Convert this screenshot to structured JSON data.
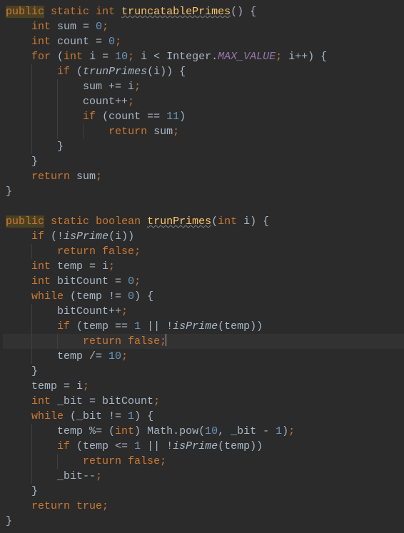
{
  "lang": "java",
  "lines": [
    {
      "i": 0,
      "hl": false,
      "tokens": [
        {
          "t": "public",
          "c": "kw-hi"
        },
        {
          "t": " "
        },
        {
          "t": "static",
          "c": "kw"
        },
        {
          "t": " "
        },
        {
          "t": "int",
          "c": "kw"
        },
        {
          "t": " "
        },
        {
          "t": "truncatablePrimes",
          "c": "fn-warn"
        },
        {
          "t": "() {",
          "c": "op"
        }
      ]
    },
    {
      "i": 1,
      "hl": false,
      "tokens": [
        {
          "t": "int",
          "c": "kw"
        },
        {
          "t": " sum = "
        },
        {
          "t": "0",
          "c": "num"
        },
        {
          "t": ";",
          "c": "semi"
        }
      ]
    },
    {
      "i": 1,
      "hl": false,
      "tokens": [
        {
          "t": "int",
          "c": "kw"
        },
        {
          "t": " count = "
        },
        {
          "t": "0",
          "c": "num"
        },
        {
          "t": ";",
          "c": "semi"
        }
      ]
    },
    {
      "i": 1,
      "hl": false,
      "tokens": [
        {
          "t": "for",
          "c": "kw"
        },
        {
          "t": " ("
        },
        {
          "t": "int",
          "c": "kw"
        },
        {
          "t": " i = "
        },
        {
          "t": "10",
          "c": "num"
        },
        {
          "t": ";",
          "c": "semi"
        },
        {
          "t": " i < Integer."
        },
        {
          "t": "MAX_VALUE",
          "c": "const-it"
        },
        {
          "t": ";",
          "c": "semi"
        },
        {
          "t": " i++) {"
        }
      ]
    },
    {
      "i": 2,
      "hl": false,
      "tokens": [
        {
          "t": "if",
          "c": "kw"
        },
        {
          "t": " ("
        },
        {
          "t": "trunPrimes",
          "c": "call-it"
        },
        {
          "t": "(i)) {"
        }
      ]
    },
    {
      "i": 3,
      "hl": false,
      "tokens": [
        {
          "t": "sum += i"
        },
        {
          "t": ";",
          "c": "semi"
        }
      ]
    },
    {
      "i": 3,
      "hl": false,
      "tokens": [
        {
          "t": "count++"
        },
        {
          "t": ";",
          "c": "semi"
        }
      ]
    },
    {
      "i": 3,
      "hl": false,
      "tokens": [
        {
          "t": "if",
          "c": "kw"
        },
        {
          "t": " (count == "
        },
        {
          "t": "11",
          "c": "num"
        },
        {
          "t": ")"
        }
      ]
    },
    {
      "i": 4,
      "hl": false,
      "tokens": [
        {
          "t": "return",
          "c": "kw"
        },
        {
          "t": " sum"
        },
        {
          "t": ";",
          "c": "semi"
        }
      ]
    },
    {
      "i": 2,
      "hl": false,
      "tokens": [
        {
          "t": "}"
        }
      ]
    },
    {
      "i": 1,
      "hl": false,
      "tokens": [
        {
          "t": "}"
        }
      ]
    },
    {
      "i": 1,
      "hl": false,
      "tokens": [
        {
          "t": "return",
          "c": "kw"
        },
        {
          "t": " sum"
        },
        {
          "t": ";",
          "c": "semi"
        }
      ]
    },
    {
      "i": 0,
      "hl": false,
      "tokens": [
        {
          "t": "}"
        }
      ]
    },
    {
      "i": 0,
      "hl": false,
      "tokens": []
    },
    {
      "i": 0,
      "hl": false,
      "tokens": [
        {
          "t": "public",
          "c": "kw-hi"
        },
        {
          "t": " "
        },
        {
          "t": "static",
          "c": "kw"
        },
        {
          "t": " "
        },
        {
          "t": "boolean",
          "c": "kw"
        },
        {
          "t": " "
        },
        {
          "t": "trunPrimes",
          "c": "fn-warn"
        },
        {
          "t": "("
        },
        {
          "t": "int",
          "c": "kw"
        },
        {
          "t": " i) {"
        }
      ]
    },
    {
      "i": 1,
      "hl": false,
      "tokens": [
        {
          "t": "if",
          "c": "kw"
        },
        {
          "t": " (!"
        },
        {
          "t": "isPrime",
          "c": "call-it"
        },
        {
          "t": "(i))"
        }
      ]
    },
    {
      "i": 2,
      "hl": false,
      "tokens": [
        {
          "t": "return false",
          "c": "kw"
        },
        {
          "t": ";",
          "c": "semi"
        }
      ]
    },
    {
      "i": 1,
      "hl": false,
      "tokens": [
        {
          "t": "int",
          "c": "kw"
        },
        {
          "t": " temp = i"
        },
        {
          "t": ";",
          "c": "semi"
        }
      ]
    },
    {
      "i": 1,
      "hl": false,
      "tokens": [
        {
          "t": "int",
          "c": "kw"
        },
        {
          "t": " bitCount = "
        },
        {
          "t": "0",
          "c": "num"
        },
        {
          "t": ";",
          "c": "semi"
        }
      ]
    },
    {
      "i": 1,
      "hl": false,
      "tokens": [
        {
          "t": "while",
          "c": "kw"
        },
        {
          "t": " (temp != "
        },
        {
          "t": "0",
          "c": "num"
        },
        {
          "t": ") {"
        }
      ]
    },
    {
      "i": 2,
      "hl": false,
      "tokens": [
        {
          "t": "bitCount++"
        },
        {
          "t": ";",
          "c": "semi"
        }
      ]
    },
    {
      "i": 2,
      "hl": false,
      "tokens": [
        {
          "t": "if",
          "c": "kw"
        },
        {
          "t": " (temp == "
        },
        {
          "t": "1",
          "c": "num"
        },
        {
          "t": " || !"
        },
        {
          "t": "isPrime",
          "c": "call-it"
        },
        {
          "t": "(temp))"
        }
      ]
    },
    {
      "i": 3,
      "hl": true,
      "cursorAfter": true,
      "tokens": [
        {
          "t": "return false",
          "c": "kw"
        },
        {
          "t": ";",
          "c": "semi"
        }
      ]
    },
    {
      "i": 2,
      "hl": false,
      "tokens": [
        {
          "t": "temp /= "
        },
        {
          "t": "10",
          "c": "num"
        },
        {
          "t": ";",
          "c": "semi"
        }
      ]
    },
    {
      "i": 1,
      "hl": false,
      "tokens": [
        {
          "t": "}"
        }
      ]
    },
    {
      "i": 1,
      "hl": false,
      "tokens": [
        {
          "t": "temp = i"
        },
        {
          "t": ";",
          "c": "semi"
        }
      ]
    },
    {
      "i": 1,
      "hl": false,
      "tokens": [
        {
          "t": "int",
          "c": "kw"
        },
        {
          "t": " _bit = bitCount"
        },
        {
          "t": ";",
          "c": "semi"
        }
      ]
    },
    {
      "i": 1,
      "hl": false,
      "tokens": [
        {
          "t": "while",
          "c": "kw"
        },
        {
          "t": " (_bit != "
        },
        {
          "t": "1",
          "c": "num"
        },
        {
          "t": ") {"
        }
      ]
    },
    {
      "i": 2,
      "hl": false,
      "tokens": [
        {
          "t": "temp %= ("
        },
        {
          "t": "int",
          "c": "kw"
        },
        {
          "t": ") Math.pow("
        },
        {
          "t": "10",
          "c": "num"
        },
        {
          "t": ","
        },
        {
          "t": " _bit - "
        },
        {
          "t": "1",
          "c": "num"
        },
        {
          "t": ")"
        },
        {
          "t": ";",
          "c": "semi"
        }
      ]
    },
    {
      "i": 2,
      "hl": false,
      "tokens": [
        {
          "t": "if",
          "c": "kw"
        },
        {
          "t": " (temp <= "
        },
        {
          "t": "1",
          "c": "num"
        },
        {
          "t": " || !"
        },
        {
          "t": "isPrime",
          "c": "call-it"
        },
        {
          "t": "(temp))"
        }
      ]
    },
    {
      "i": 3,
      "hl": false,
      "tokens": [
        {
          "t": "return false",
          "c": "kw"
        },
        {
          "t": ";",
          "c": "semi"
        }
      ]
    },
    {
      "i": 2,
      "hl": false,
      "tokens": [
        {
          "t": "_bit--"
        },
        {
          "t": ";",
          "c": "semi"
        }
      ]
    },
    {
      "i": 1,
      "hl": false,
      "tokens": [
        {
          "t": "}"
        }
      ]
    },
    {
      "i": 1,
      "hl": false,
      "tokens": [
        {
          "t": "return true",
          "c": "kw"
        },
        {
          "t": ";",
          "c": "semi"
        }
      ]
    },
    {
      "i": 0,
      "hl": false,
      "tokens": [
        {
          "t": "}"
        }
      ]
    }
  ]
}
